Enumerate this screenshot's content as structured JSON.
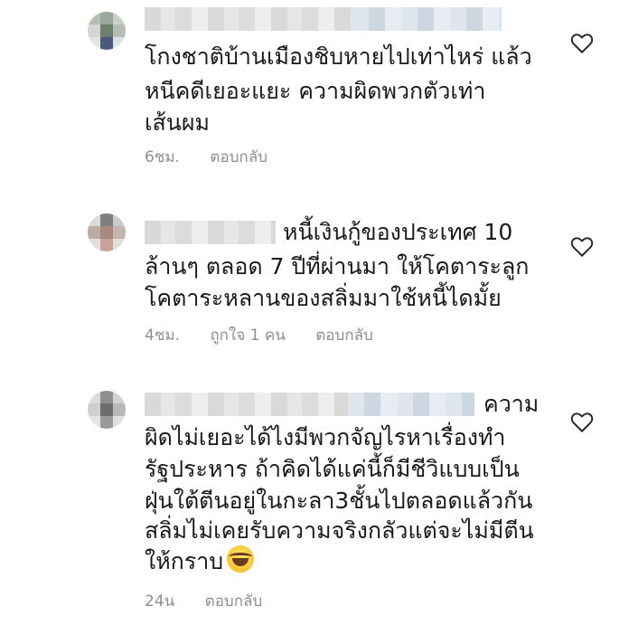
{
  "comments": [
    {
      "lines": [
        "โกงชาติบ้านเมืองชิบหายไปเท่าไหร่ แล้ว",
        "หนีคดีเยอะแยะ ความผิดพวกตัวเท่า",
        "เส้นผม"
      ],
      "time": "6ชม.",
      "reply": "ตอบกลับ",
      "likes": ""
    },
    {
      "lines": [
        "หนี้เงินกู้ของประเทศ 10",
        "ล้านๆ ตลอด 7 ปีที่ผ่านมา ให้โคตาระลูก",
        "โคตาระหลานของสลิ่มมาใช้หนี้ไดมั้ย"
      ],
      "time": "4ชม.",
      "likes": "ถูกใจ 1 คน",
      "reply": "ตอบกลับ"
    },
    {
      "lines": [
        "ความ",
        "ผิดไม่เยอะได้ไงมีพวกจัญไรหาเรื่องทำ",
        "รัฐประหาร ถ้าคิดได้แค่นี้ก็มีชีวิแบบเป็น",
        "ฝุ่นใต้ตีนอยู่ในกะลา3ชั้นไปตลอดแล้วกัน",
        "สลิ่มไม่เคยรับความจริงกลัวแต่จะไม่มีตีน",
        "ให้กราบ"
      ],
      "time": "24น",
      "reply": "ตอบกลับ",
      "likes": "",
      "emoji": "laughing-crying-emoji"
    }
  ],
  "colors": {
    "text": "#1a1a1a",
    "meta": "#8e8e8e",
    "heart_stroke": "#262626"
  },
  "icons": {
    "like": "heart-outline-icon"
  }
}
